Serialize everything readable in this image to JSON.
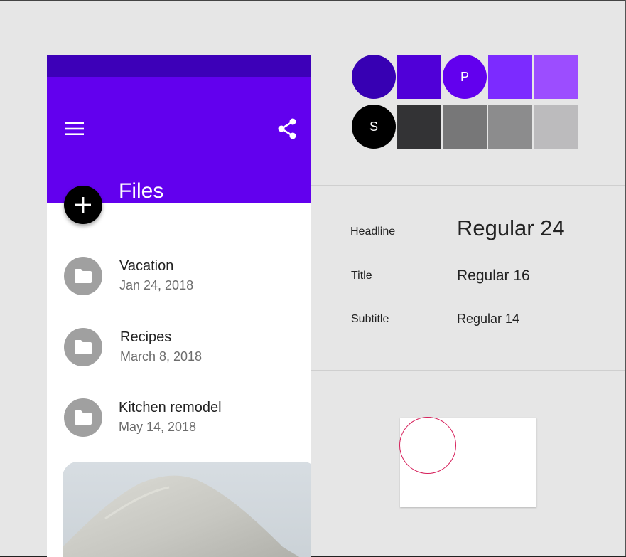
{
  "colors": {
    "status_bar": "#3d00b8",
    "app_bar": "#6200ee",
    "primary_dark": "#3700b3",
    "primary": "#5000d8",
    "primary_p": "#6200ee",
    "primary_light": "#7c2bff",
    "primary_lighter": "#9c4dff",
    "secondary": "#000000",
    "gray_1": "#333335",
    "gray_2": "#777778",
    "gray_3": "#8c8c8d",
    "gray_4": "#bcbbbd",
    "folder_avatar": "#a0a0a0",
    "shape_outline": "#d61f5a"
  },
  "app_bar": {
    "title": "Files",
    "menu_icon": "menu-icon",
    "share_icon": "share-icon"
  },
  "fab": {
    "icon": "plus-icon"
  },
  "files": [
    {
      "name": "Vacation",
      "date": "Jan 24, 2018",
      "icon": "folder-icon"
    },
    {
      "name": "Recipes",
      "date": "March 8, 2018",
      "icon": "folder-icon"
    },
    {
      "name": "Kitchen remodel",
      "date": "May 14, 2018",
      "icon": "folder-icon"
    }
  ],
  "palette": {
    "primary_row": [
      {
        "shape": "circle",
        "color": "#3700b3",
        "label": ""
      },
      {
        "shape": "square",
        "color": "#5000d8",
        "label": ""
      },
      {
        "shape": "circle",
        "color": "#6200ee",
        "label": "P"
      },
      {
        "shape": "square",
        "color": "#7c2bff",
        "label": ""
      },
      {
        "shape": "square",
        "color": "#9c4dff",
        "label": ""
      }
    ],
    "secondary_row": [
      {
        "shape": "circle",
        "color": "#000000",
        "label": "S"
      },
      {
        "shape": "square",
        "color": "#333335",
        "label": ""
      },
      {
        "shape": "square",
        "color": "#777778",
        "label": ""
      },
      {
        "shape": "square",
        "color": "#8c8c8d",
        "label": ""
      },
      {
        "shape": "square",
        "color": "#bcbbbd",
        "label": ""
      }
    ]
  },
  "typography": [
    {
      "label": "Headline",
      "sample": "Regular 24"
    },
    {
      "label": "Title",
      "sample": "Regular 16"
    },
    {
      "label": "Subtitle",
      "sample": "Regular 14"
    }
  ]
}
